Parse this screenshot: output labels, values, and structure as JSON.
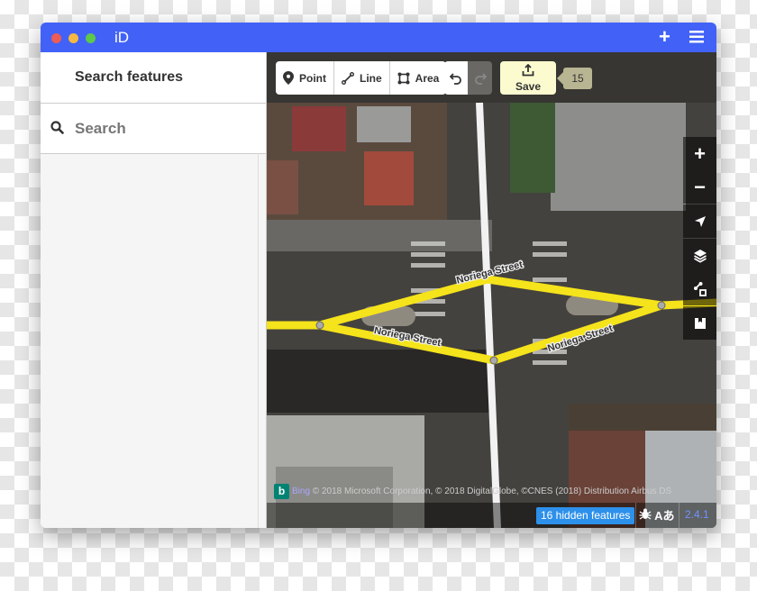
{
  "window": {
    "title": "iD",
    "traffic_lights": [
      "#ed5b55",
      "#f5b941",
      "#5dc84a"
    ],
    "accent": "#4262f7",
    "titlebar_icons": [
      "plus-icon",
      "hamburger-menu-icon"
    ]
  },
  "sidebar": {
    "header": "Search features",
    "search_placeholder": "Search"
  },
  "toolbar": {
    "modes": [
      {
        "label": "Point",
        "icon": "point-pin-icon"
      },
      {
        "label": "Line",
        "icon": "line-icon"
      },
      {
        "label": "Area",
        "icon": "area-icon"
      }
    ],
    "undo_icon": "undo-icon",
    "redo_icon": "redo-icon",
    "save_label": "Save",
    "save_icon": "upload-icon",
    "edit_count": "15"
  },
  "map_controls": [
    {
      "name": "zoom-in",
      "icon": "plus-icon"
    },
    {
      "name": "zoom-out",
      "icon": "minus-icon"
    },
    {
      "name": "geolocate",
      "icon": "location-arrow-icon"
    },
    {
      "name": "background",
      "icon": "layers-icon"
    },
    {
      "name": "map-data",
      "icon": "data-icon"
    },
    {
      "name": "help",
      "icon": "help-icon"
    }
  ],
  "map": {
    "street_labels": [
      "Noriega Street",
      "Noriega Street",
      "Noriega Street"
    ],
    "road_color": "#f5e31b"
  },
  "attribution": {
    "provider": "Bing",
    "text": "© 2018 Microsoft Corporation, © 2018 DigitalGlobe, ©CNES (2018) Distribution Airbus DS"
  },
  "footer": {
    "hidden_features": "16 hidden features",
    "issues_text": "Aあ",
    "version": "2.4.1"
  }
}
